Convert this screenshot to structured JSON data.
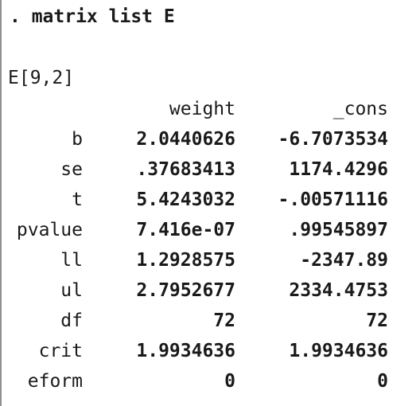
{
  "command": ". matrix list E",
  "matrix_label": "E[9,2]",
  "columns": [
    "weight",
    "_cons"
  ],
  "rows": [
    {
      "name": "b",
      "weight": "2.0440626",
      "cons": "-6.7073534"
    },
    {
      "name": "se",
      "weight": ".37683413",
      "cons": "1174.4296"
    },
    {
      "name": "t",
      "weight": "5.4243032",
      "cons": "-.00571116"
    },
    {
      "name": "pvalue",
      "weight": "7.416e-07",
      "cons": ".99545897"
    },
    {
      "name": "ll",
      "weight": "1.2928575",
      "cons": "-2347.89"
    },
    {
      "name": "ul",
      "weight": "2.7952677",
      "cons": "2334.4753"
    },
    {
      "name": "df",
      "weight": "72",
      "cons": "72"
    },
    {
      "name": "crit",
      "weight": "1.9934636",
      "cons": "1.9934636"
    },
    {
      "name": "eform",
      "weight": "0",
      "cons": "0"
    }
  ]
}
